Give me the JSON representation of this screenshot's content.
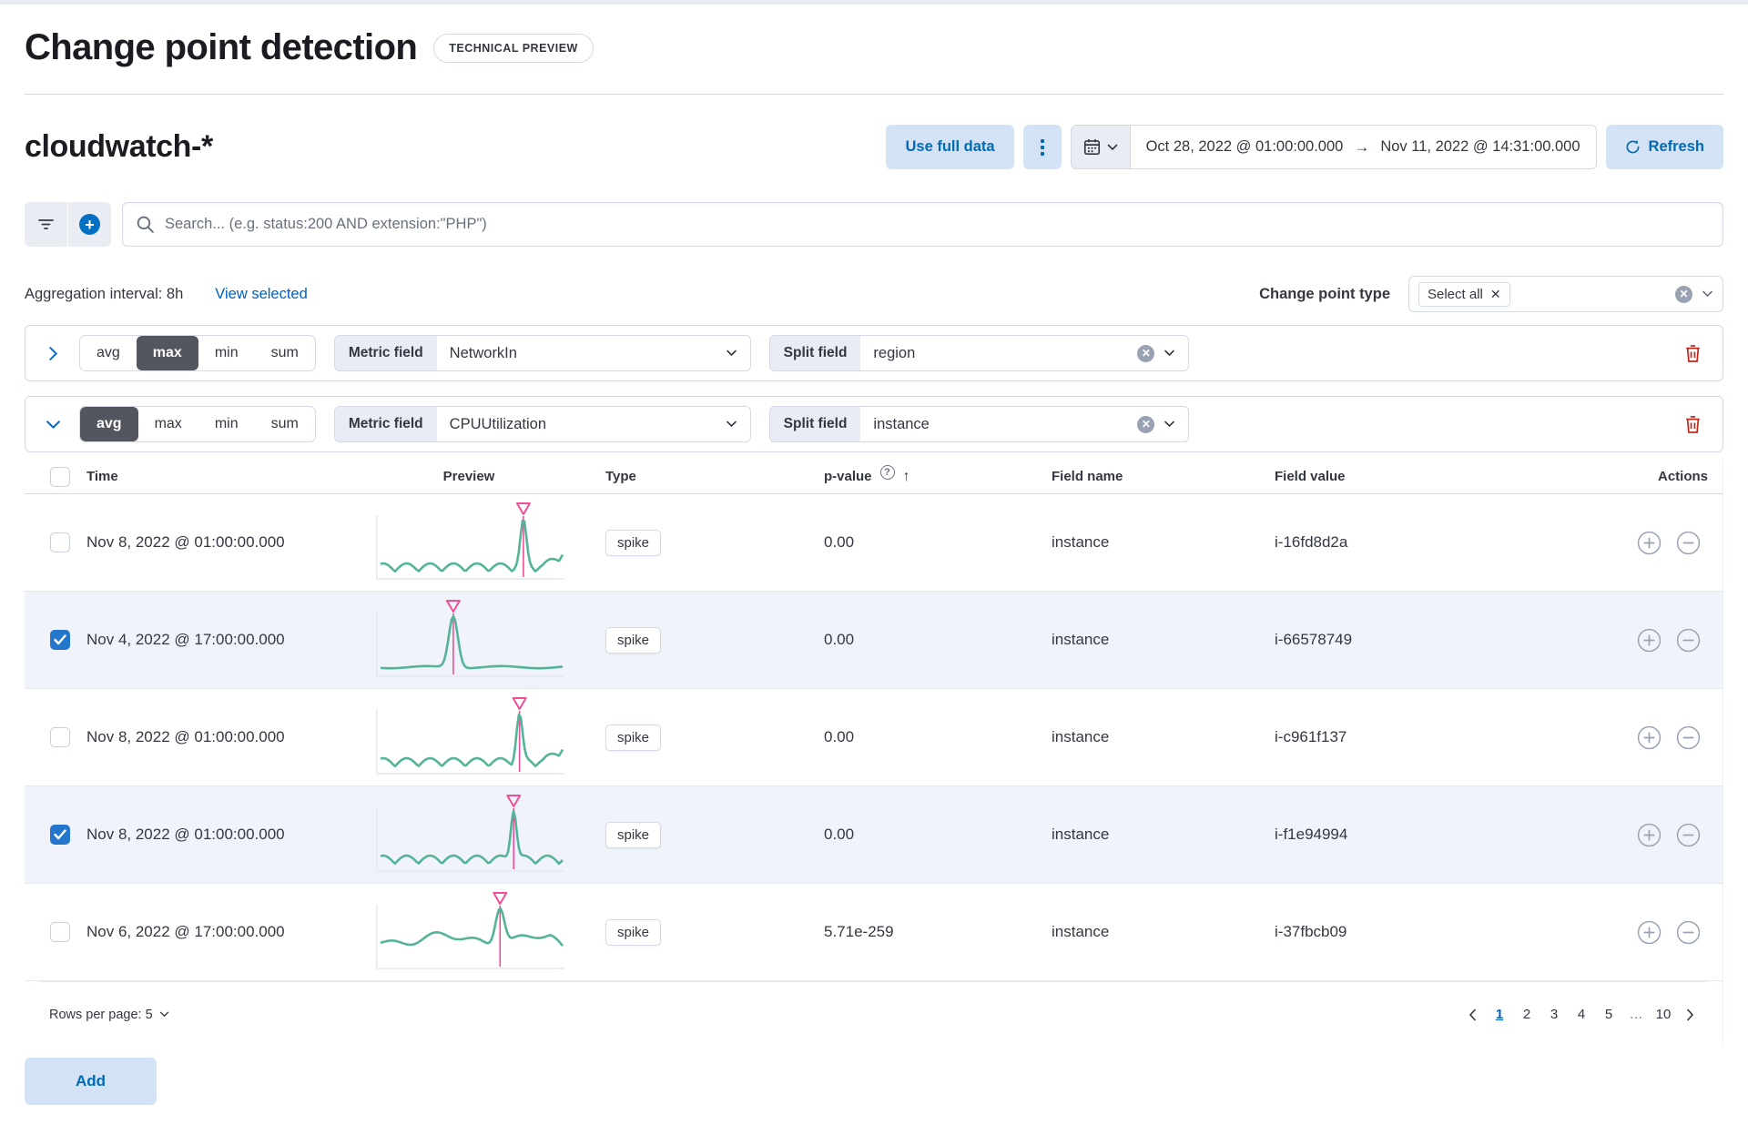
{
  "page": {
    "title": "Change point detection",
    "badge": "TECHNICAL PREVIEW"
  },
  "header": {
    "index_title": "cloudwatch-*",
    "use_full_data": "Use full data",
    "date_start": "Oct 28, 2022 @ 01:00:00.000",
    "date_end": "Nov 11, 2022 @ 14:31:00.000",
    "refresh": "Refresh"
  },
  "search": {
    "placeholder": "Search... (e.g. status:200 AND extension:\"PHP\")"
  },
  "meta": {
    "aggregation_label": "Aggregation interval: 8h",
    "view_selected": "View selected",
    "change_point_type_label": "Change point type",
    "selected_type": "Select all"
  },
  "function_options": [
    "avg",
    "max",
    "min",
    "sum"
  ],
  "panels": [
    {
      "collapsed": true,
      "selected_function": "max",
      "metric_label": "Metric field",
      "metric_value": "NetworkIn",
      "split_label": "Split field",
      "split_value": "region"
    },
    {
      "collapsed": false,
      "selected_function": "avg",
      "metric_label": "Metric field",
      "metric_value": "CPUUtilization",
      "split_label": "Split field",
      "split_value": "instance"
    }
  ],
  "table": {
    "columns": [
      "Time",
      "Preview",
      "Type",
      "p-value",
      "Field name",
      "Field value",
      "Actions"
    ],
    "rows": [
      {
        "checked": false,
        "time": "Nov 8, 2022 @ 01:00:00.000",
        "type": "spike",
        "p_value": "0.00",
        "field_name": "instance",
        "field_value": "i-16fd8d2a",
        "spark": {
          "pattern": "wavy",
          "spike": 0.78,
          "end": "rise"
        }
      },
      {
        "checked": true,
        "time": "Nov 4, 2022 @ 17:00:00.000",
        "type": "spike",
        "p_value": "0.00",
        "field_name": "instance",
        "field_value": "i-66578749",
        "spark": {
          "pattern": "flat",
          "spike": 0.42,
          "end": "flat"
        }
      },
      {
        "checked": false,
        "time": "Nov 8, 2022 @ 01:00:00.000",
        "type": "spike",
        "p_value": "0.00",
        "field_name": "instance",
        "field_value": "i-c961f137",
        "spark": {
          "pattern": "wavy",
          "spike": 0.76,
          "end": "rise"
        }
      },
      {
        "checked": true,
        "time": "Nov 8, 2022 @ 01:00:00.000",
        "type": "spike",
        "p_value": "0.00",
        "field_name": "instance",
        "field_value": "i-f1e94994",
        "spark": {
          "pattern": "wavy",
          "spike": 0.73,
          "end": "flat"
        }
      },
      {
        "checked": false,
        "time": "Nov 6, 2022 @ 17:00:00.000",
        "type": "spike",
        "p_value": "5.71e-259",
        "field_name": "instance",
        "field_value": "i-37fbcb09",
        "spark": {
          "pattern": "noisy",
          "spike": 0.66,
          "end": "drop"
        }
      }
    ]
  },
  "pagination": {
    "rows_per_page": "Rows per page: 5",
    "pages": [
      "1",
      "2",
      "3",
      "4",
      "5",
      "…",
      "10"
    ],
    "active_page": "1"
  },
  "footer": {
    "add": "Add"
  },
  "colors": {
    "spark_green": "#54b399",
    "spark_pink": "#f04e98",
    "blue": "#0061c4"
  }
}
